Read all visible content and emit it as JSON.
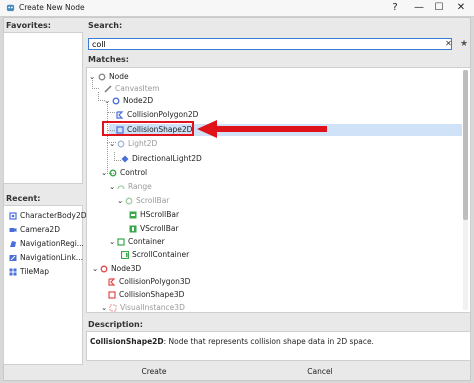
{
  "window": {
    "title": "Create New Node",
    "controls": {
      "help": "?",
      "minimize": "—",
      "maximize": "☐",
      "close": "✕"
    }
  },
  "favorites": {
    "label": "Favorites:"
  },
  "recent": {
    "label": "Recent:",
    "items": [
      {
        "label": "CharacterBody2D",
        "icon": "character-body-2d-icon"
      },
      {
        "label": "Camera2D",
        "icon": "camera-2d-icon"
      },
      {
        "label": "NavigationRegi...",
        "icon": "navigation-region-icon"
      },
      {
        "label": "NavigationLink...",
        "icon": "navigation-link-icon"
      },
      {
        "label": "TileMap",
        "icon": "tilemap-icon"
      }
    ]
  },
  "search": {
    "label": "Search:",
    "value": "coll",
    "clear": "✕",
    "favorite": "★"
  },
  "matches": {
    "label": "Matches:",
    "items": [
      {
        "label": "Node",
        "grey": false,
        "arrow": "⌄",
        "icon": "node-icon"
      },
      {
        "label": "CanvasItem",
        "grey": true,
        "arrow": "",
        "icon": "canvas-item-icon"
      },
      {
        "label": "Node2D",
        "grey": false,
        "arrow": "⌄",
        "icon": "node-2d-icon"
      },
      {
        "label": "CollisionPolygon2D",
        "grey": false,
        "arrow": "",
        "icon": "collision-polygon-2d-icon"
      },
      {
        "label": "CollisionShape2D",
        "grey": false,
        "arrow": "",
        "icon": "collision-shape-2d-icon",
        "selected": true
      },
      {
        "label": "Light2D",
        "grey": true,
        "arrow": "⌄",
        "icon": "light-2d-icon"
      },
      {
        "label": "DirectionalLight2D",
        "grey": false,
        "arrow": "",
        "icon": "directional-light-2d-icon"
      },
      {
        "label": "Control",
        "grey": false,
        "arrow": "⌄",
        "icon": "control-icon"
      },
      {
        "label": "Range",
        "grey": true,
        "arrow": "⌄",
        "icon": "range-icon"
      },
      {
        "label": "ScrollBar",
        "grey": true,
        "arrow": "⌄",
        "icon": "scrollbar-icon"
      },
      {
        "label": "HScrollBar",
        "grey": false,
        "arrow": "",
        "icon": "hscrollbar-icon"
      },
      {
        "label": "VScrollBar",
        "grey": false,
        "arrow": "",
        "icon": "vscrollbar-icon"
      },
      {
        "label": "Container",
        "grey": false,
        "arrow": "⌄",
        "icon": "container-icon"
      },
      {
        "label": "ScrollContainer",
        "grey": false,
        "arrow": "",
        "icon": "scroll-container-icon"
      },
      {
        "label": "Node3D",
        "grey": false,
        "arrow": "⌄",
        "icon": "node-3d-icon"
      },
      {
        "label": "CollisionPolygon3D",
        "grey": false,
        "arrow": "",
        "icon": "collision-polygon-3d-icon"
      },
      {
        "label": "CollisionShape3D",
        "grey": false,
        "arrow": "",
        "icon": "collision-shape-3d-icon"
      },
      {
        "label": "VisualInstance3D",
        "grey": true,
        "arrow": "⌄",
        "icon": "visual-instance-3d-icon"
      }
    ]
  },
  "description": {
    "label": "Description:",
    "node_name": "CollisionShape2D",
    "text": ": Node that represents collision shape data in 2D space."
  },
  "buttons": {
    "create": "Create",
    "cancel": "Cancel"
  },
  "colors": {
    "node_2d": "#4a6ed9",
    "control": "#3aa84a",
    "node_3d": "#e04a4a",
    "base_node": "#888888",
    "selection": "#cfe2f7",
    "annotation_red": "#e0121a"
  }
}
